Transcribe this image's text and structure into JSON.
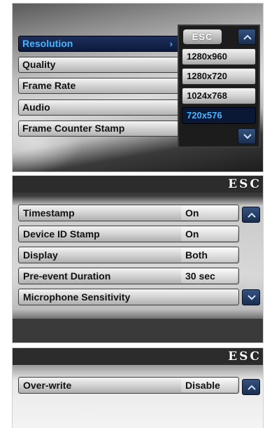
{
  "panel1": {
    "menu_items": [
      {
        "label": "Resolution",
        "selected": true,
        "arrow": "›"
      },
      {
        "label": "Quality"
      },
      {
        "label": "Frame Rate"
      },
      {
        "label": "Audio"
      },
      {
        "label": "Frame Counter Stamp"
      }
    ],
    "submenu": {
      "esc_label": "ESC",
      "options": [
        "1280x960",
        "1280x720",
        "1024x768",
        "720x576"
      ],
      "selected_option": "720x576"
    }
  },
  "panel2": {
    "esc_label": "ESC",
    "rows": [
      {
        "label": "Timestamp",
        "value": "On"
      },
      {
        "label": "Device ID Stamp",
        "value": "On"
      },
      {
        "label": "Display",
        "value": "Both"
      },
      {
        "label": "Pre-event Duration",
        "value": "30 sec"
      },
      {
        "label": "Microphone Sensitivity",
        "value": ""
      }
    ]
  },
  "panel3": {
    "esc_label": "ESC",
    "rows": [
      {
        "label": "Over-write",
        "value": "Disable"
      }
    ]
  },
  "colors": {
    "selected_bg": "#0c1a3d",
    "selected_text": "#48b4ff",
    "scroll_button": "#1b2e4f"
  },
  "icons": {
    "scroll_up": "chevron-up-icon",
    "scroll_down": "chevron-down-icon"
  }
}
